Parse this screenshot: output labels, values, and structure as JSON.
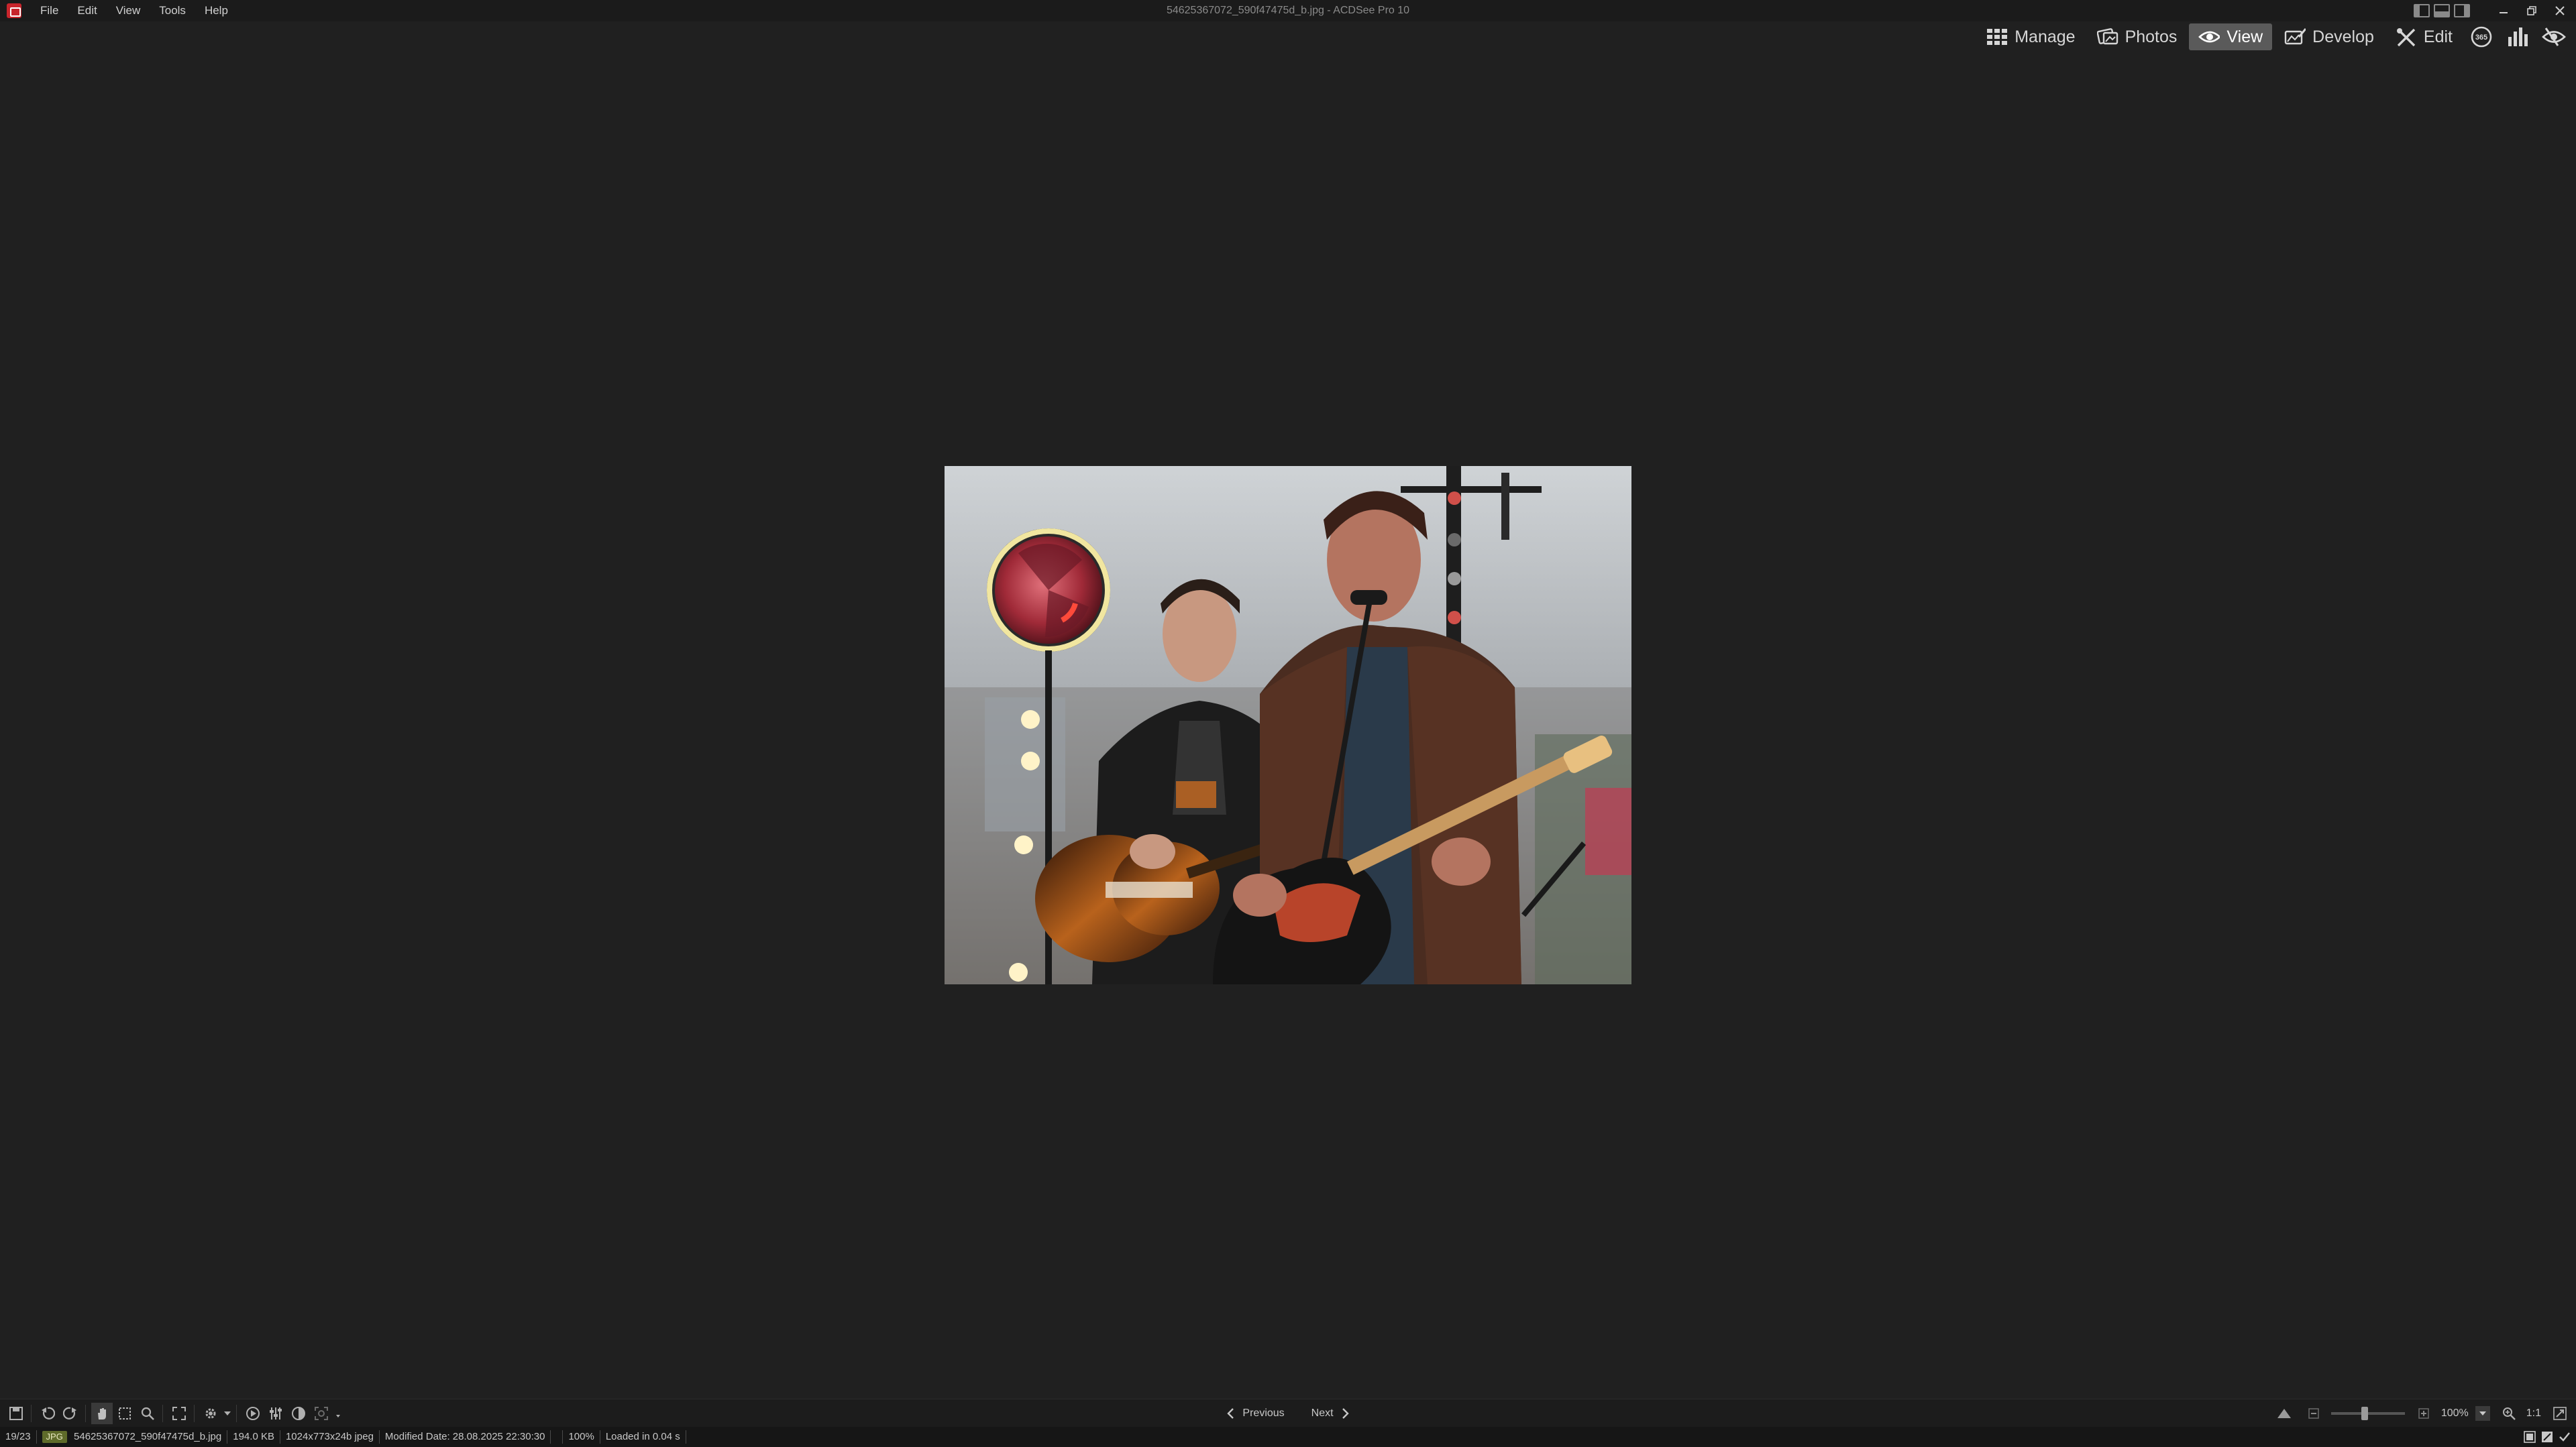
{
  "window": {
    "title": "54625367072_590f47475d_b.jpg - ACDSee Pro 10"
  },
  "menu": {
    "items": [
      {
        "label": "File"
      },
      {
        "label": "Edit"
      },
      {
        "label": "View"
      },
      {
        "label": "Tools"
      },
      {
        "label": "Help"
      }
    ]
  },
  "modes": {
    "manage": "Manage",
    "photos": "Photos",
    "view": "View",
    "develop": "Develop",
    "edit": "Edit",
    "active": "View",
    "dashboard_icon_text": "365"
  },
  "viewer": {
    "image_subject": "Two musicians on stage with electric guitars; singer in brown leather jacket at microphone",
    "image_zoom_percent": 100
  },
  "navigation": {
    "previous": "Previous",
    "next": "Next"
  },
  "zoom": {
    "value": "100%",
    "ratio_label": "1:1",
    "slider_fraction": 0.45
  },
  "status": {
    "position": "19/23",
    "format_badge": "JPG",
    "filename": "54625367072_590f47475d_b.jpg",
    "filesize": "194.0 KB",
    "dimensions": "1024x773x24b jpeg",
    "modified": "Modified Date: 28.08.2025 22:30:30",
    "zoom": "100%",
    "load_time": "Loaded in 0.04 s"
  },
  "colors": {
    "background": "#202020",
    "menubar": "#1b1b1b",
    "active_mode": "#5a5a5a",
    "badge": "#5f6b2a",
    "app_icon": "#c8252c"
  }
}
